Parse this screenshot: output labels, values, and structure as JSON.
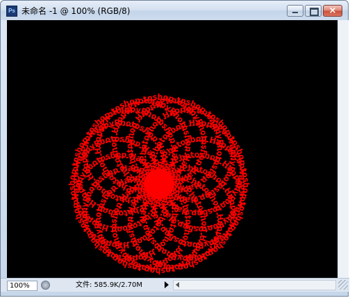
{
  "window": {
    "title": "未命名 -1 @ 100% (RGB/8)",
    "icon": "photoshop-icon",
    "controls": {
      "minimize": "minimize-icon",
      "maximize": "maximize-icon",
      "close_glyph": "×"
    }
  },
  "canvas": {
    "background": "#000000",
    "artwork": {
      "text": "HappyPhotoshop",
      "color": "#ff0000",
      "description_shape": "text-on-path rosette"
    }
  },
  "status": {
    "zoom": "100%",
    "doc_info": "文件: 585.9K/2.70M"
  }
}
